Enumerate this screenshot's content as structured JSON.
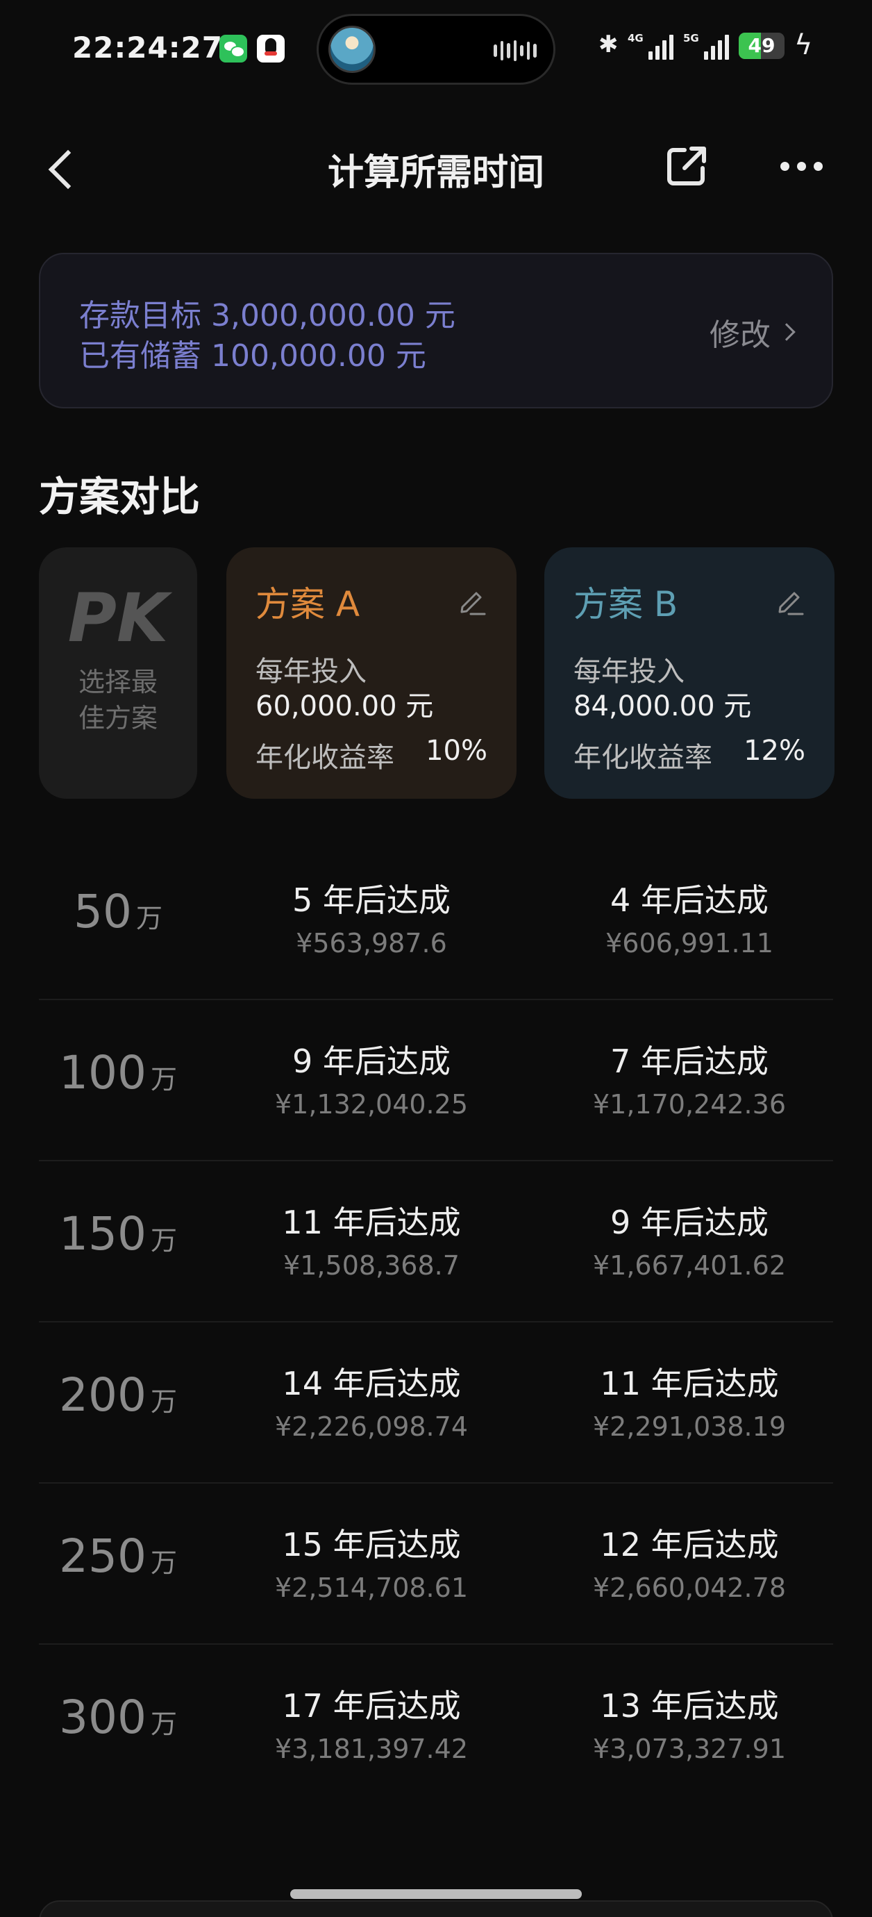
{
  "status_bar": {
    "time": "22:24:27",
    "network_a": "4G",
    "network_b": "5G",
    "battery_level": "49"
  },
  "nav": {
    "title": "计算所需时间"
  },
  "goal_card": {
    "target_line": "存款目标 3,000,000.00 元",
    "saved_line": "已有储蓄 100,000.00 元",
    "modify_label": "修改"
  },
  "section": {
    "title": "方案对比"
  },
  "pk_card": {
    "logo": "PK",
    "subtitle": "选择最佳方案"
  },
  "plans": {
    "a": {
      "name": "方案 A",
      "annual_label": "每年投入",
      "annual_amount": "60,000.00 元",
      "rate_label": "年化收益率",
      "rate": "10%",
      "color": "#e08a3c"
    },
    "b": {
      "name": "方案 B",
      "annual_label": "每年投入",
      "annual_amount": "84,000.00 元",
      "rate_label": "年化收益率",
      "rate": "12%",
      "color": "#5e9fb3"
    }
  },
  "results": [
    {
      "goal": "50",
      "unit": "万",
      "a_years": "5 年后达成",
      "a_amount": "¥563,987.6",
      "b_years": "4 年后达成",
      "b_amount": "¥606,991.11"
    },
    {
      "goal": "100",
      "unit": "万",
      "a_years": "9 年后达成",
      "a_amount": "¥1,132,040.25",
      "b_years": "7 年后达成",
      "b_amount": "¥1,170,242.36"
    },
    {
      "goal": "150",
      "unit": "万",
      "a_years": "11 年后达成",
      "a_amount": "¥1,508,368.7",
      "b_years": "9 年后达成",
      "b_amount": "¥1,667,401.62"
    },
    {
      "goal": "200",
      "unit": "万",
      "a_years": "14 年后达成",
      "a_amount": "¥2,226,098.74",
      "b_years": "11 年后达成",
      "b_amount": "¥2,291,038.19"
    },
    {
      "goal": "250",
      "unit": "万",
      "a_years": "15 年后达成",
      "a_amount": "¥2,514,708.61",
      "b_years": "12 年后达成",
      "b_amount": "¥2,660,042.78"
    },
    {
      "goal": "300",
      "unit": "万",
      "a_years": "17 年后达成",
      "a_amount": "¥3,181,397.42",
      "b_years": "13 年后达成",
      "b_amount": "¥3,073,327.91"
    }
  ]
}
